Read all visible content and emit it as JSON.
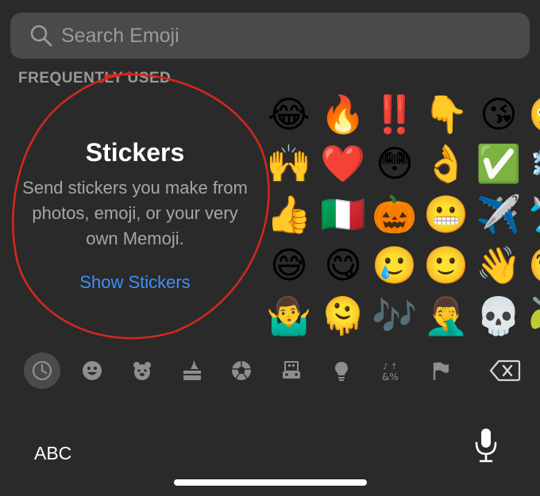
{
  "search": {
    "placeholder": "Search Emoji"
  },
  "section": {
    "title": "FREQUENTLY USED"
  },
  "stickers": {
    "title": "Stickers",
    "description": "Send stickers you make from photos, emoji, or your very own Memoji.",
    "link": "Show Stickers"
  },
  "emojis": [
    [
      "😂",
      "🔥",
      "‼️",
      "👇",
      "😘",
      "🤪"
    ],
    [
      "🙌",
      "❤️",
      "😳",
      "👌",
      "✅",
      "❄️"
    ],
    [
      "👍",
      "🇮🇹",
      "🎃",
      "😬",
      "✈️",
      "🛩️"
    ],
    [
      "😅",
      "😋",
      "🥲",
      "🙂",
      "👋",
      "🧐"
    ],
    [
      "🤷‍♂️",
      "🫠",
      "🎶",
      "🤦‍♂️",
      "💀",
      "🫒"
    ]
  ],
  "categories": [
    "recent-clock",
    "smileys",
    "animals",
    "food",
    "activity",
    "travel",
    "objects",
    "symbols",
    "flags"
  ],
  "keyboard": {
    "abc_label": "ABC"
  },
  "colors": {
    "background": "#2a2a2a",
    "accent": "#3f8ff7",
    "annotation": "#d2281e"
  }
}
